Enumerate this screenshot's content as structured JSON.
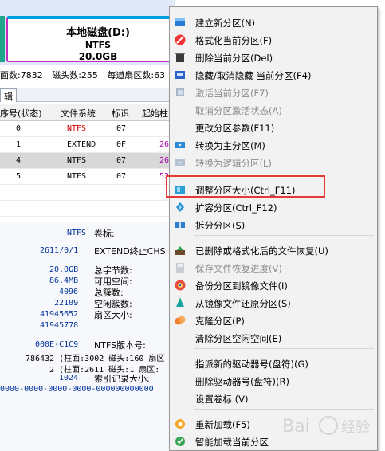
{
  "disk": {
    "partition_name": "本地磁盘(D:)",
    "filesystem": "NTFS",
    "size": "20.0GB"
  },
  "geometry": {
    "cylinders": "面数:7832",
    "heads": "磁头数:255",
    "sectors": "每道扇区数:63"
  },
  "tab_label": "辑",
  "table": {
    "headers": [
      "序号(状态)",
      "文件系统",
      "标识",
      "起始柱"
    ],
    "rows": [
      {
        "num": "0",
        "fs": "NTFS",
        "id": "07",
        "start": "",
        "fs_color": "#cc0000",
        "selected": false
      },
      {
        "num": "1",
        "fs": "EXTEND",
        "id": "0F",
        "start": "26",
        "fs_color": "#000000",
        "selected": false
      },
      {
        "num": "4",
        "fs": "NTFS",
        "id": "07",
        "start": "26",
        "fs_color": "#000000",
        "selected": true
      },
      {
        "num": "5",
        "fs": "NTFS",
        "id": "07",
        "start": "52",
        "fs_color": "#000000",
        "selected": false
      }
    ]
  },
  "details": {
    "fs_value": "NTFS",
    "fs_label": "卷标:",
    "chs_value": "2611/0/1",
    "chs_label": "EXTEND终止CHS:",
    "size_total": "20.0GB",
    "size_total_label": "总字节数:",
    "size_free": "86.4MB",
    "size_free_label": "可用空间:",
    "cluster_size": "4096",
    "cluster_size_label": "总簇数:",
    "total_clusters": "22109",
    "total_clusters_label": "空闲簇数:",
    "sectors_a": "41945652",
    "sectors_a_label": "扇区大小:",
    "sectors_b": "41945778",
    "serial": "000E-C1C9",
    "serial_label": "NTFS版本号:",
    "mft_a": "786432 (柱面:3002 磁头:160 扇区",
    "mft_b": "2 (柱面:2611 磁头:1 扇区:",
    "index_size": "1024",
    "index_label": "索引记录大小:",
    "guid": "0000-0000-0000-0000-000000000000"
  },
  "menu": {
    "items": [
      {
        "label": "建立新分区(N)",
        "icon": "new-partition-icon",
        "disabled": false
      },
      {
        "label": "格式化当前分区(F)",
        "icon": "format-icon",
        "disabled": false
      },
      {
        "label": "删除当前分区(Del)",
        "icon": "delete-icon",
        "disabled": false
      },
      {
        "label": "隐藏/取消隐藏 当前分区(F4)",
        "icon": "hide-icon",
        "disabled": false
      },
      {
        "label": "激活当前分区(F7)",
        "icon": "activate-icon",
        "disabled": true
      },
      {
        "label": "取消分区激活状态(A)",
        "icon": "",
        "disabled": true
      },
      {
        "label": "更改分区参数(F11)",
        "icon": "",
        "disabled": false
      },
      {
        "label": "转换为主分区(M)",
        "icon": "to-primary-icon",
        "disabled": false
      },
      {
        "label": "转换为逻辑分区(L)",
        "icon": "to-logical-icon",
        "disabled": true
      },
      {
        "label": "调整分区大小(Ctrl_F11)",
        "icon": "resize-icon",
        "disabled": false
      },
      {
        "label": "扩容分区(Ctrl_F12)",
        "icon": "expand-icon",
        "disabled": false
      },
      {
        "label": "拆分分区(S)",
        "icon": "split-icon",
        "disabled": false
      },
      {
        "label": "已删除或格式化后的文件恢复(U)",
        "icon": "file-recovery-icon",
        "disabled": false
      },
      {
        "label": "保存文件恢复进度(V)",
        "icon": "save-progress-icon",
        "disabled": true
      },
      {
        "label": "备份分区到镜像文件(I)",
        "icon": "backup-icon",
        "disabled": false
      },
      {
        "label": "从镜像文件还原分区(S)",
        "icon": "restore-icon",
        "disabled": false
      },
      {
        "label": "克隆分区(P)",
        "icon": "clone-icon",
        "disabled": false
      },
      {
        "label": "清除分区空闲空间(E)",
        "icon": "",
        "disabled": false
      },
      {
        "label": "指派新的驱动器号(盘符)(G)",
        "icon": "",
        "disabled": false
      },
      {
        "label": "删除驱动器号(盘符)(R)",
        "icon": "",
        "disabled": false
      },
      {
        "label": "设置卷标 (V)",
        "icon": "",
        "disabled": false
      },
      {
        "label": "重新加载(F5)",
        "icon": "reload-icon",
        "disabled": false
      },
      {
        "label": "智能加载当前分区",
        "icon": "smart-load-icon",
        "disabled": false
      }
    ]
  },
  "colors": {
    "highlight": "#e53935",
    "disabled_text": "#8c8c8c",
    "value_blue": "#003399",
    "purple_start": "#aa00aa"
  }
}
